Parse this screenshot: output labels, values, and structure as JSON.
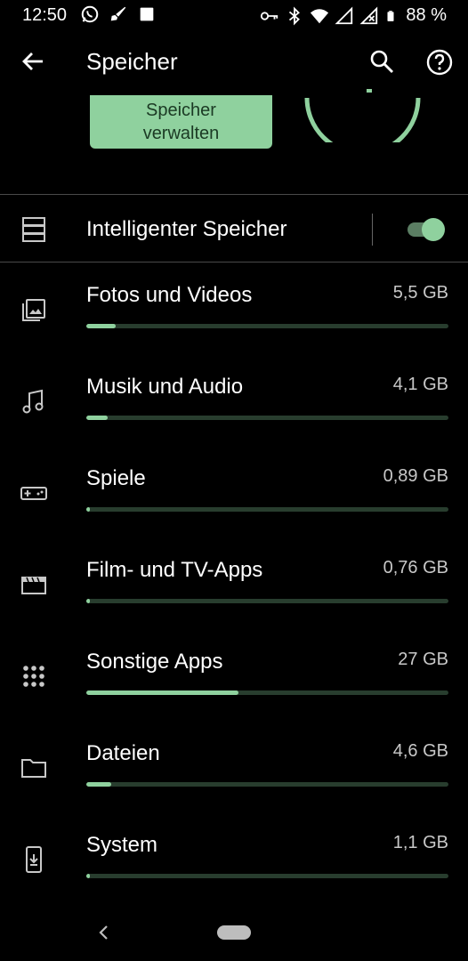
{
  "status_bar": {
    "time": "12:50",
    "battery_text": "88 %",
    "left_icons": [
      "whatsapp-icon",
      "rocket-icon",
      "square-icon"
    ],
    "right_icons": [
      "key-icon",
      "bluetooth-icon",
      "wifi-icon",
      "signal-icon",
      "signal-off-icon",
      "battery-icon"
    ]
  },
  "app_bar": {
    "title": "Speicher",
    "back_icon": "arrow-back-icon",
    "search_icon": "search-icon",
    "help_icon": "help-icon"
  },
  "manage": {
    "label_line1": "Speicher",
    "label_line2": "verwalten"
  },
  "smart_storage": {
    "label": "Intelligenter Speicher",
    "icon": "storage-icon",
    "enabled": true
  },
  "items": [
    {
      "label": "Fotos und Videos",
      "size": "5,5 GB",
      "fraction": 0.08,
      "icon": "photos-icon"
    },
    {
      "label": "Musik und Audio",
      "size": "4,1 GB",
      "fraction": 0.06,
      "icon": "music-note-icon"
    },
    {
      "label": "Spiele",
      "size": "0,89 GB",
      "fraction": 0.01,
      "icon": "gamepad-icon"
    },
    {
      "label": "Film- und TV-Apps",
      "size": "0,76 GB",
      "fraction": 0.01,
      "icon": "movie-icon"
    },
    {
      "label": "Sonstige Apps",
      "size": "27 GB",
      "fraction": 0.42,
      "icon": "apps-grid-icon"
    },
    {
      "label": "Dateien",
      "size": "4,6 GB",
      "fraction": 0.07,
      "icon": "folder-icon"
    },
    {
      "label": "System",
      "size": "1,1 GB",
      "fraction": 0.01,
      "icon": "system-phone-icon"
    }
  ],
  "colors": {
    "accent": "#8fd19e",
    "track": "#283d2e",
    "background": "#000000"
  }
}
